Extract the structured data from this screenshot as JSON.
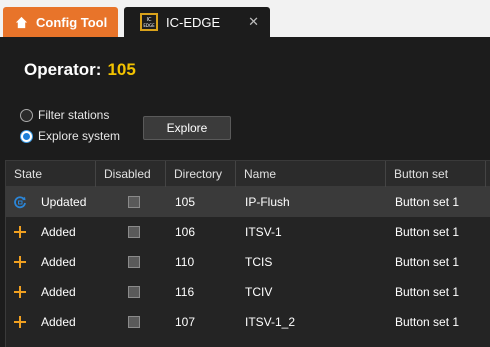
{
  "tabs": {
    "config_label": "Config Tool",
    "edge_label": "IC-EDGE",
    "edge_icon_text": "IC EDGE",
    "close_glyph": "✕"
  },
  "operator": {
    "label": "Operator:",
    "number": "105"
  },
  "options": {
    "filter_label": "Filter stations",
    "explore_label": "Explore system",
    "selected": "explore"
  },
  "explore_button": "Explore",
  "table": {
    "columns": [
      "State",
      "Disabled",
      "Directory",
      "Name",
      "Button set"
    ],
    "rows": [
      {
        "state": "Updated",
        "state_icon": "sync-icon",
        "disabled": false,
        "directory": "105",
        "name": "IP-Flush",
        "button_set": "Button set 1"
      },
      {
        "state": "Added",
        "state_icon": "plus-icon",
        "disabled": false,
        "directory": "106",
        "name": "ITSV-1",
        "button_set": "Button set 1"
      },
      {
        "state": "Added",
        "state_icon": "plus-icon",
        "disabled": false,
        "directory": "110",
        "name": "TCIS",
        "button_set": "Button set 1"
      },
      {
        "state": "Added",
        "state_icon": "plus-icon",
        "disabled": false,
        "directory": "116",
        "name": "TCIV",
        "button_set": "Button set 1"
      },
      {
        "state": "Added",
        "state_icon": "plus-icon",
        "disabled": false,
        "directory": "107",
        "name": "ITSV-1_2",
        "button_set": "Button set 1"
      }
    ]
  },
  "colors": {
    "accent_orange": "#e8742a",
    "operator_number": "#f2c200",
    "added_icon": "#f0a020",
    "updated_icon": "#2b86d8"
  }
}
